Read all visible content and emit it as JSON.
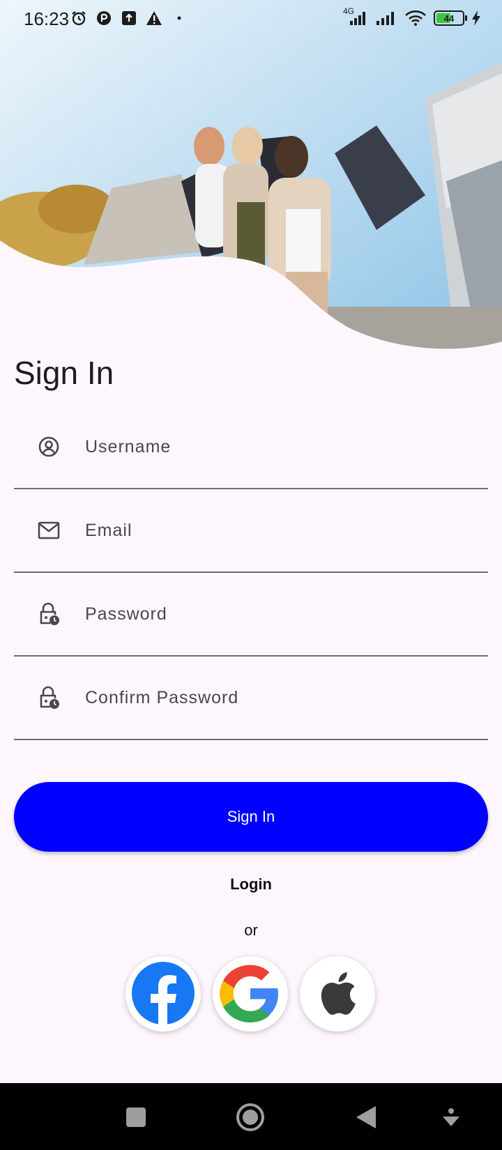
{
  "status_bar": {
    "time": "16:23",
    "network_label": "4G",
    "battery_level": "44"
  },
  "page": {
    "title": "Sign In"
  },
  "form": {
    "username_placeholder": "Username",
    "email_placeholder": "Email",
    "password_placeholder": "Password",
    "confirm_password_placeholder": "Confirm Password"
  },
  "actions": {
    "signin_label": "Sign In",
    "login_label": "Login",
    "or_label": "or"
  },
  "social": [
    {
      "name": "facebook",
      "icon": "facebook-icon"
    },
    {
      "name": "google",
      "icon": "google-icon"
    },
    {
      "name": "apple",
      "icon": "apple-icon"
    }
  ],
  "colors": {
    "primary": "#0000ff",
    "background": "#fdf7fd",
    "facebook": "#1877f2"
  }
}
